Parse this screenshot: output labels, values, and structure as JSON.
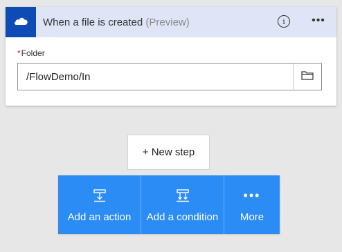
{
  "trigger": {
    "title": "When a file is created",
    "title_suffix": "(Preview)",
    "service_icon": "onedrive-cloud-icon",
    "service_color": "#0f4bb5",
    "header_color": "#dfe4f6",
    "info_glyph": "i",
    "more_glyph": "•••",
    "field": {
      "required_mark": "*",
      "label": "Folder",
      "value": "/FlowDemo/In",
      "picker_icon": "folder-icon"
    }
  },
  "new_step": {
    "label": "+ New step"
  },
  "actions": {
    "bar_color": "#2b8cf6",
    "items": [
      {
        "label": "Add an action",
        "icon": "add-action-icon"
      },
      {
        "label": "Add a condition",
        "icon": "add-condition-icon"
      },
      {
        "label": "More",
        "icon": "more-dots-icon",
        "glyph": "•••"
      }
    ]
  }
}
